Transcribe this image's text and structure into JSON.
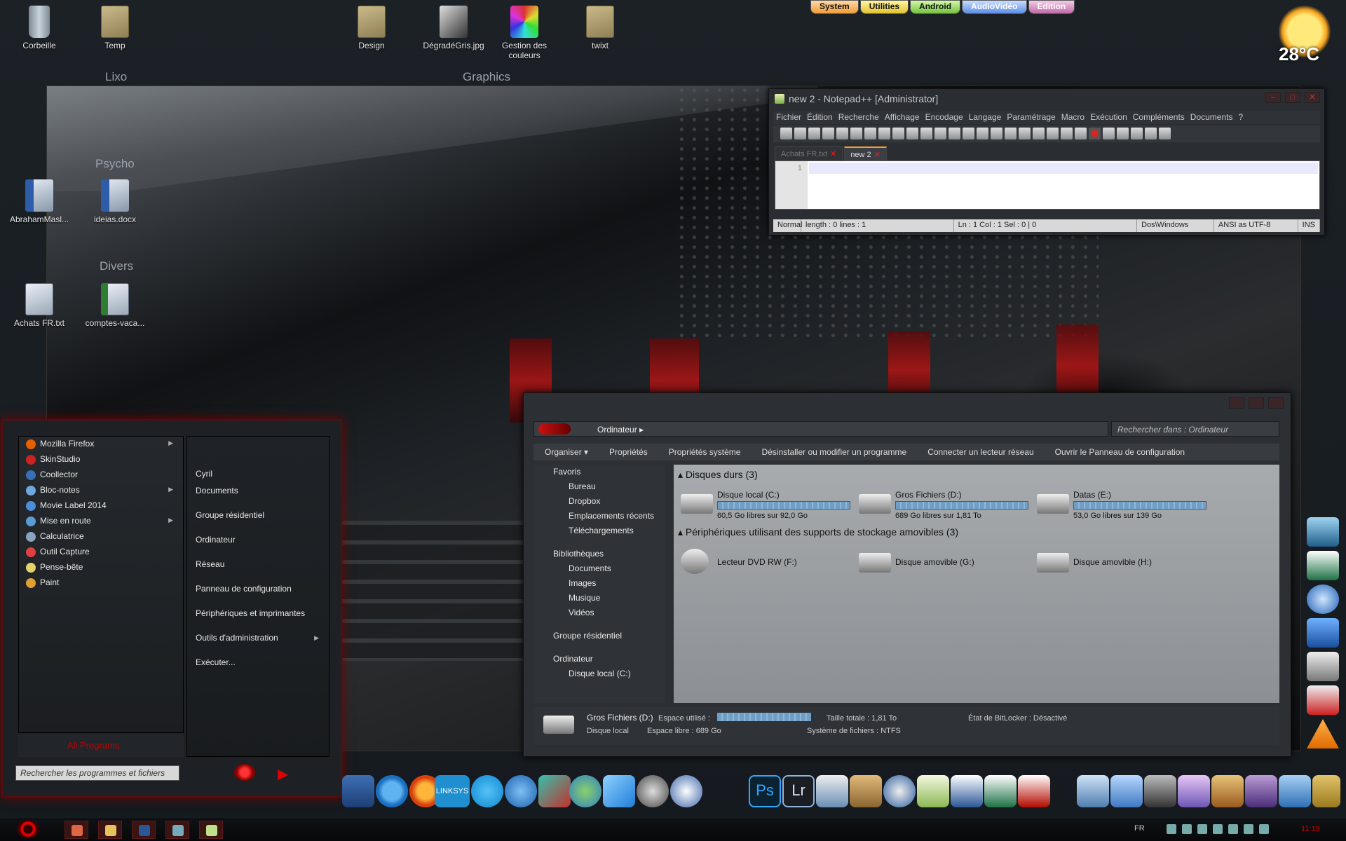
{
  "desktop": {
    "icons": [
      {
        "label": "Corbeille",
        "icon": "recycle-bin-icon"
      },
      {
        "label": "Temp",
        "icon": "folder-icon"
      },
      {
        "label": "Design",
        "icon": "folder-icon"
      },
      {
        "label": "DégradéGris.jpg",
        "icon": "image-file-icon"
      },
      {
        "label": "Gestion des couleurs",
        "icon": "color-management-icon"
      },
      {
        "label": "twixt",
        "icon": "folder-icon"
      },
      {
        "label": "AbrahamMasl...",
        "icon": "word-document-icon"
      },
      {
        "label": "ideias.docx",
        "icon": "word-document-icon"
      },
      {
        "label": "Achats FR.txt",
        "icon": "text-file-icon"
      },
      {
        "label": "comptes-vaca...",
        "icon": "spreadsheet-icon"
      }
    ],
    "groups": [
      "Lixo",
      "Graphics",
      "Psycho",
      "Divers"
    ]
  },
  "top_tabs": [
    "System",
    "Utilities",
    "Android",
    "AudioVidéo",
    "Edition"
  ],
  "weather": {
    "temperature": "28°C",
    "icon": "sun-icon"
  },
  "notepad": {
    "title": "new  2 - Notepad++ [Administrator]",
    "menu": [
      "Fichier",
      "Édition",
      "Recherche",
      "Affichage",
      "Encodage",
      "Langage",
      "Paramétrage",
      "Macro",
      "Exécution",
      "Compléments",
      "Documents",
      "?"
    ],
    "tabs": [
      {
        "label": "Achats FR.txt",
        "active": false
      },
      {
        "label": "new  2",
        "active": true
      }
    ],
    "line_number": "1",
    "status": [
      "Normal",
      "length : 0    lines : 1",
      "Ln : 1    Col : 1    Sel : 0 | 0",
      "Dos\\Windows",
      "ANSI as UTF-8",
      "INS"
    ]
  },
  "explorer": {
    "address": "Ordinateur",
    "search_placeholder": "Rechercher dans : Ordinateur",
    "commands": [
      "Organiser ▾",
      "Propriétés",
      "Propriétés système",
      "Désinstaller ou modifier un programme",
      "Connecter un lecteur réseau",
      "Ouvrir le Panneau de configuration"
    ],
    "nav": {
      "favorites": "Favoris",
      "fav_items": [
        "Bureau",
        "Dropbox",
        "Emplacements récents",
        "Téléchargements"
      ],
      "libraries": "Bibliothèques",
      "lib_items": [
        "Documents",
        "Images",
        "Musique",
        "Vidéos"
      ],
      "homegroup": "Groupe résidentiel",
      "computer": "Ordinateur",
      "comp_items": [
        "Disque local (C:)"
      ]
    },
    "sections": {
      "hard_disks": "Disques durs (3)",
      "removable": "Périphériques utilisant des supports de stockage amovibles (3)"
    },
    "drives": [
      {
        "name": "Disque local (C:)",
        "free": "60,5 Go libres sur 92,0 Go",
        "used_fraction": 0.34
      },
      {
        "name": "Gros Fichiers (D:)",
        "free": "689 Go libres sur 1,81 To",
        "used_fraction": 0.63
      },
      {
        "name": "Datas (E:)",
        "free": "53,0 Go libres sur 139 Go",
        "used_fraction": 0.62
      }
    ],
    "removable": [
      {
        "name": "Lecteur DVD RW (F:)"
      },
      {
        "name": "Disque amovible (G:)"
      },
      {
        "name": "Disque amovible (H:)"
      }
    ],
    "details": {
      "name": "Gros Fichiers (D:)",
      "type": "Disque local",
      "used_label": "Espace utilisé :",
      "free_label": "Espace libre : 689 Go",
      "total": "Taille totale : 1,81 To",
      "fs": "Système de fichiers : NTFS",
      "bitlocker": "État de BitLocker : Désactivé"
    }
  },
  "start_menu": {
    "programs": [
      {
        "label": "Mozilla Firefox",
        "submenu": true,
        "color": "#e66000"
      },
      {
        "label": "SkinStudio",
        "submenu": false,
        "color": "#cc2222"
      },
      {
        "label": "Coollector",
        "submenu": false,
        "color": "#3a6fb5"
      },
      {
        "label": "Bloc-notes",
        "submenu": true,
        "color": "#6fa8dc"
      },
      {
        "label": "Movie Label 2014",
        "submenu": false,
        "color": "#4c8ed6"
      },
      {
        "label": "Mise en route",
        "submenu": true,
        "color": "#5a9bd5"
      },
      {
        "label": "Calculatrice",
        "submenu": false,
        "color": "#8aa4bf"
      },
      {
        "label": "Outil Capture",
        "submenu": false,
        "color": "#e04040"
      },
      {
        "label": "Pense-bête",
        "submenu": false,
        "color": "#e6d26a"
      },
      {
        "label": "Paint",
        "submenu": false,
        "color": "#e0a030"
      }
    ],
    "all_programs": "All Programs",
    "places": [
      {
        "label": "Cyril",
        "submenu": false
      },
      {
        "label": "Documents",
        "submenu": false
      },
      {
        "label": "Groupe résidentiel",
        "submenu": false
      },
      {
        "label": "Ordinateur",
        "submenu": false
      },
      {
        "label": "Réseau",
        "submenu": false
      },
      {
        "label": "Panneau de configuration",
        "submenu": false
      },
      {
        "label": "Périphériques et imprimantes",
        "submenu": false
      },
      {
        "label": "Outils d'administration",
        "submenu": true
      },
      {
        "label": "Exécuter...",
        "submenu": false
      }
    ],
    "search_placeholder": "Rechercher les programmes et fichiers"
  },
  "dock": [
    {
      "label": "LINKSYS",
      "icon": "linksys-icon"
    }
  ],
  "dock_icons": [
    "teamviewer-icon",
    "internet-explorer-icon",
    "firefox-icon",
    "linksys-icon",
    "skype-icon",
    "google-earth-icon",
    "xmind-icon",
    "globe-icon",
    "dropbox-icon",
    "virtualdj-icon",
    "terminal-icon",
    "photoshop-icon",
    "lightroom-icon",
    "scanner-icon",
    "box-icon",
    "lock-icon",
    "notepad-icon",
    "word-icon",
    "excel-icon",
    "acrobat-icon",
    "computer-icon",
    "folder-icon",
    "camera-icon",
    "itunes-icon",
    "tools-icon",
    "movie-icon",
    "downloads-icon",
    "android-icon"
  ],
  "dock_text": {
    "ps": "Ps",
    "lr": "Lr"
  },
  "gadgets": [
    "coollector-icon",
    "excel-icon",
    "itunes-icon",
    "music-icon",
    "speaker-icon",
    "countdown-icon",
    "vlc-icon"
  ],
  "taskbar": {
    "lang": "FR",
    "time": "11:18"
  }
}
